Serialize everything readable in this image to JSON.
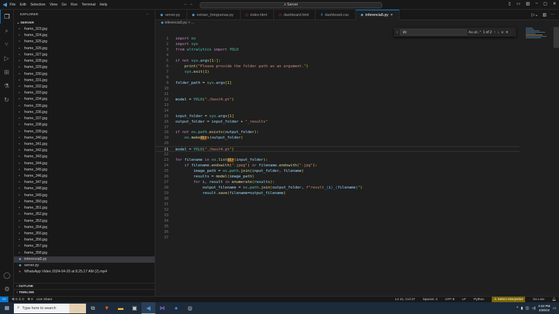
{
  "title_bar": {
    "menu": [
      "File",
      "Edit",
      "Selection",
      "View",
      "Go",
      "Run",
      "Terminal",
      "Help"
    ],
    "search": "Server",
    "nav": "← →"
  },
  "sidebar": {
    "title": "EXPLORER",
    "more": "···",
    "folder": "SERVER",
    "files": [
      {
        "name": "frame_323.jpg",
        "icon": "image"
      },
      {
        "name": "frame_324.jpg",
        "icon": "image"
      },
      {
        "name": "frame_325.jpg",
        "icon": "image"
      },
      {
        "name": "frame_326.jpg",
        "icon": "image"
      },
      {
        "name": "frame_327.jpg",
        "icon": "image"
      },
      {
        "name": "frame_328.jpg",
        "icon": "image"
      },
      {
        "name": "frame_329.jpg",
        "icon": "image"
      },
      {
        "name": "frame_330.jpg",
        "icon": "image"
      },
      {
        "name": "frame_331.jpg",
        "icon": "image"
      },
      {
        "name": "frame_332.jpg",
        "icon": "image"
      },
      {
        "name": "frame_333.jpg",
        "icon": "image"
      },
      {
        "name": "frame_334.jpg",
        "icon": "image"
      },
      {
        "name": "frame_335.jpg",
        "icon": "image"
      },
      {
        "name": "frame_336.jpg",
        "icon": "image"
      },
      {
        "name": "frame_337.jpg",
        "icon": "image"
      },
      {
        "name": "frame_338.jpg",
        "icon": "image"
      },
      {
        "name": "frame_339.jpg",
        "icon": "image"
      },
      {
        "name": "frame_340.jpg",
        "icon": "image"
      },
      {
        "name": "frame_341.jpg",
        "icon": "image"
      },
      {
        "name": "frame_342.jpg",
        "icon": "image"
      },
      {
        "name": "frame_343.jpg",
        "icon": "image"
      },
      {
        "name": "frame_344.jpg",
        "icon": "image"
      },
      {
        "name": "frame_345.jpg",
        "icon": "image"
      },
      {
        "name": "frame_346.jpg",
        "icon": "image"
      },
      {
        "name": "frame_347.jpg",
        "icon": "image"
      },
      {
        "name": "frame_348.jpg",
        "icon": "image"
      },
      {
        "name": "frame_349.jpg",
        "icon": "image"
      },
      {
        "name": "frame_350.jpg",
        "icon": "image"
      },
      {
        "name": "frame_351.jpg",
        "icon": "image"
      },
      {
        "name": "frame_352.jpg",
        "icon": "image"
      },
      {
        "name": "frame_353.jpg",
        "icon": "image"
      },
      {
        "name": "frame_354.jpg",
        "icon": "image"
      },
      {
        "name": "frame_355.jpg",
        "icon": "image"
      },
      {
        "name": "frame_356.jpg",
        "icon": "image"
      },
      {
        "name": "frame_357.jpg",
        "icon": "image"
      },
      {
        "name": "frame_358.jpg",
        "icon": "image"
      },
      {
        "name": "inferencia5.py",
        "icon": "python",
        "selected": true
      },
      {
        "name": "server.py",
        "icon": "python"
      },
      {
        "name": "WhatsApp Video 2024-04-20 at 8.25.17 AM (2).mp4",
        "icon": "video"
      }
    ],
    "outline": "OUTLINE",
    "timeline": "TIMELINE"
  },
  "tabs": [
    {
      "label": "server.py",
      "icon": "python"
    },
    {
      "label": "extraer_fotogramas.py",
      "icon": "python"
    },
    {
      "label": "index.html",
      "icon": "html"
    },
    {
      "label": "dashboard.html",
      "icon": "html"
    },
    {
      "label": "dashboard.css",
      "icon": "css"
    },
    {
      "label": "inferencia5.py",
      "icon": "python",
      "active": true,
      "close": "×"
    }
  ],
  "breadcrumb": "inferencia5.py > ...",
  "find": {
    "query": "dir",
    "options": "Aa ab .*",
    "result": "1 of 2"
  },
  "editor": {
    "current_line": 21,
    "lines": [
      [
        [
          "import",
          "k"
        ],
        [
          " os",
          "m"
        ]
      ],
      [
        [
          "import",
          "k"
        ],
        [
          " sys",
          "m"
        ]
      ],
      [
        [
          "from",
          "k"
        ],
        [
          " ultralytics ",
          "m"
        ],
        [
          "import",
          "k"
        ],
        [
          " YOLO",
          "m"
        ]
      ],
      [],
      [
        [
          "if not",
          "k"
        ],
        [
          " sys",
          "m"
        ],
        [
          ".",
          "p"
        ],
        [
          "argv",
          "v"
        ],
        [
          "[",
          "b1"
        ],
        [
          "1:",
          "n"
        ],
        [
          "]",
          "b1"
        ],
        [
          ":",
          "p"
        ]
      ],
      [
        [
          "    ",
          "p"
        ],
        [
          "print",
          "f"
        ],
        [
          "(",
          "b1"
        ],
        [
          "\"Please provide the folder path as an argument.\"",
          "s"
        ],
        [
          ")",
          "b1"
        ]
      ],
      [
        [
          "    ",
          "p"
        ],
        [
          "sys",
          "m"
        ],
        [
          ".",
          "p"
        ],
        [
          "exit",
          "f"
        ],
        [
          "(",
          "b1"
        ],
        [
          "1",
          "n"
        ],
        [
          ")",
          "b1"
        ]
      ],
      [],
      [
        [
          "folder_path",
          "v"
        ],
        [
          " = ",
          "p"
        ],
        [
          "sys",
          "m"
        ],
        [
          ".",
          "p"
        ],
        [
          "argv",
          "v"
        ],
        [
          "[",
          "b1"
        ],
        [
          "1",
          "n"
        ],
        [
          "]",
          "b1"
        ]
      ],
      [],
      [],
      [
        [
          "model",
          "v"
        ],
        [
          " = ",
          "p"
        ],
        [
          "YOLO",
          "m"
        ],
        [
          "(",
          "b1"
        ],
        [
          "\"./best4.pt\"",
          "s"
        ],
        [
          ")",
          "b1"
        ]
      ],
      [],
      [],
      [
        [
          "input_folder",
          "v"
        ],
        [
          " = ",
          "p"
        ],
        [
          "sys",
          "m"
        ],
        [
          ".",
          "p"
        ],
        [
          "argv",
          "v"
        ],
        [
          "[",
          "b1"
        ],
        [
          "1",
          "n"
        ],
        [
          "]",
          "b1"
        ]
      ],
      [
        [
          "output_folder",
          "v"
        ],
        [
          " = ",
          "p"
        ],
        [
          "input_folder",
          "v"
        ],
        [
          " + ",
          "p"
        ],
        [
          "\"_results\"",
          "s"
        ]
      ],
      [],
      [
        [
          "if not",
          "k"
        ],
        [
          " os",
          "m"
        ],
        [
          ".",
          "p"
        ],
        [
          "path",
          "m"
        ],
        [
          ".",
          "p"
        ],
        [
          "exists",
          "f"
        ],
        [
          "(",
          "b1"
        ],
        [
          "output_folder",
          "v"
        ],
        [
          ")",
          "b1"
        ],
        [
          ":",
          "p"
        ]
      ],
      [
        [
          "    ",
          "p"
        ],
        [
          "os",
          "m"
        ],
        [
          ".",
          "p"
        ],
        [
          "make",
          "f"
        ],
        [
          "dir",
          "f hl"
        ],
        [
          "s",
          "f"
        ],
        [
          "(",
          "b1"
        ],
        [
          "output_folder",
          "v"
        ],
        [
          ")",
          "b1"
        ]
      ],
      [],
      [
        [
          "model",
          "v"
        ],
        [
          " = ",
          "p"
        ],
        [
          "YOLO",
          "m"
        ],
        [
          "(",
          "b1"
        ],
        [
          "\"./best4.pt\"",
          "s"
        ],
        [
          ")",
          "b1"
        ]
      ],
      [],
      [
        [
          "for",
          "k"
        ],
        [
          " filename ",
          "v"
        ],
        [
          "in",
          "k"
        ],
        [
          " os",
          "m"
        ],
        [
          ".",
          "p"
        ],
        [
          "list",
          "f"
        ],
        [
          "dir",
          "f hl"
        ],
        [
          "(",
          "b1"
        ],
        [
          "input_folder",
          "v"
        ],
        [
          ")",
          "b1"
        ],
        [
          ":",
          "p"
        ]
      ],
      [
        [
          "    ",
          "p"
        ],
        [
          "if",
          "k"
        ],
        [
          " filename",
          "v"
        ],
        [
          ".",
          "p"
        ],
        [
          "endswith",
          "f"
        ],
        [
          "(",
          "b1"
        ],
        [
          "\".jpeg\"",
          "s"
        ],
        [
          ")",
          "b1"
        ],
        [
          " or ",
          "k"
        ],
        [
          "filename",
          "v"
        ],
        [
          ".",
          "p"
        ],
        [
          "endswith",
          "f"
        ],
        [
          "(",
          "b1"
        ],
        [
          "\".jpg\"",
          "s"
        ],
        [
          ")",
          "b1"
        ],
        [
          ":",
          "p"
        ]
      ],
      [
        [
          "        ",
          "p"
        ],
        [
          "image_path",
          "v"
        ],
        [
          " = ",
          "p"
        ],
        [
          "os",
          "m"
        ],
        [
          ".",
          "p"
        ],
        [
          "path",
          "m"
        ],
        [
          ".",
          "p"
        ],
        [
          "join",
          "f"
        ],
        [
          "(",
          "b1"
        ],
        [
          "input_folder",
          "v"
        ],
        [
          ", ",
          "p"
        ],
        [
          "filename",
          "v"
        ],
        [
          ")",
          "b1"
        ]
      ],
      [
        [
          "        ",
          "p"
        ],
        [
          "results",
          "v"
        ],
        [
          " = ",
          "p"
        ],
        [
          "model",
          "f"
        ],
        [
          "(",
          "b1"
        ],
        [
          "image_path",
          "v"
        ],
        [
          ")",
          "b1"
        ]
      ],
      [
        [
          "        ",
          "p"
        ],
        [
          "for",
          "k"
        ],
        [
          " i",
          "v"
        ],
        [
          ", ",
          "p"
        ],
        [
          "result ",
          "v"
        ],
        [
          "in",
          "k"
        ],
        [
          " enumerate",
          "f"
        ],
        [
          "(",
          "b1"
        ],
        [
          "results",
          "v"
        ],
        [
          ")",
          "b1"
        ],
        [
          ":",
          "p"
        ]
      ],
      [
        [
          "            ",
          "p"
        ],
        [
          "output_filename",
          "v"
        ],
        [
          " = ",
          "p"
        ],
        [
          "os",
          "m"
        ],
        [
          ".",
          "p"
        ],
        [
          "path",
          "m"
        ],
        [
          ".",
          "p"
        ],
        [
          "join",
          "f"
        ],
        [
          "(",
          "b1"
        ],
        [
          "output_folder",
          "v"
        ],
        [
          ", ",
          "p"
        ],
        [
          "f",
          "k"
        ],
        [
          "\"result_",
          "s"
        ],
        [
          "{",
          "b3"
        ],
        [
          "i",
          "v"
        ],
        [
          "}",
          "b3"
        ],
        [
          "_",
          "s"
        ],
        [
          "{",
          "b3"
        ],
        [
          "filename",
          "v"
        ],
        [
          "}",
          "b3"
        ],
        [
          "\"",
          "s"
        ],
        [
          ")",
          "b1"
        ]
      ],
      [
        [
          "            ",
          "p"
        ],
        [
          "result",
          "v"
        ],
        [
          ".",
          "p"
        ],
        [
          "save",
          "f"
        ],
        [
          "(",
          "b1"
        ],
        [
          "filename",
          "v"
        ],
        [
          "=",
          "p"
        ],
        [
          "output_filename",
          "v"
        ],
        [
          ")",
          "b1"
        ]
      ],
      [],
      [],
      [],
      [],
      [],
      [],
      [],
      []
    ]
  },
  "status": {
    "remote": "><",
    "problems": "⊗ 0 ⚠ 0",
    "ports": "⛯ 0",
    "live_share": "Live Share",
    "position": "Ln 21, Col 27",
    "spaces": "Spaces: 4",
    "encoding": "UTF-8",
    "eol": "LF",
    "language": "Python",
    "interpreter": "⚠ Select Interpreter",
    "go_live": "Go Live"
  },
  "taskbar": {
    "search_placeholder": "Type here to search",
    "time": "2:42 PM",
    "date": "4/20/24"
  }
}
